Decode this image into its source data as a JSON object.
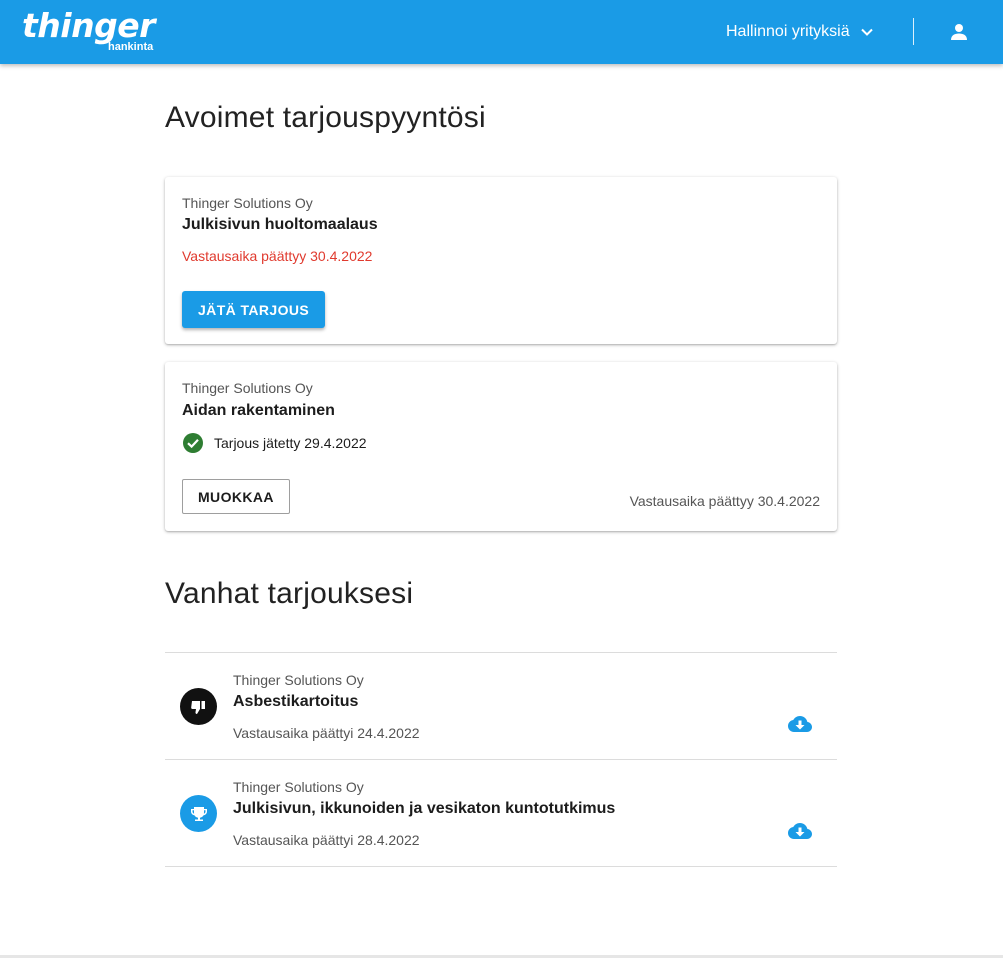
{
  "header": {
    "logo_main": "thinger",
    "logo_sub": "hankinta",
    "company_menu_label": "Hallinnoi yrityksiä",
    "brand_color": "#1a9be6"
  },
  "open_section": {
    "heading": "Avoimet tarjouspyyntösi",
    "cards": [
      {
        "company": "Thinger Solutions Oy",
        "title": "Julkisivun huoltomaalaus",
        "deadline": "Vastausaika päättyy 30.4.2022",
        "button_label": "JÄTÄ TARJOUS"
      },
      {
        "company": "Thinger Solutions Oy",
        "title": "Aidan rakentaminen",
        "status": "Tarjous jätetty 29.4.2022",
        "button_label": "MUOKKAA",
        "deadline": "Vastausaika päättyy 30.4.2022"
      }
    ]
  },
  "old_section": {
    "heading": "Vanhat tarjouksesi",
    "items": [
      {
        "company": "Thinger Solutions Oy",
        "title": "Asbestikartoitus",
        "deadline": "Vastausaika päättyi 24.4.2022",
        "status_icon": "thumb-down-icon"
      },
      {
        "company": "Thinger Solutions Oy",
        "title": "Julkisivun, ikkunoiden ja vesikaton kuntotutkimus",
        "deadline": "Vastausaika päättyi 28.4.2022",
        "status_icon": "trophy-icon"
      }
    ]
  }
}
